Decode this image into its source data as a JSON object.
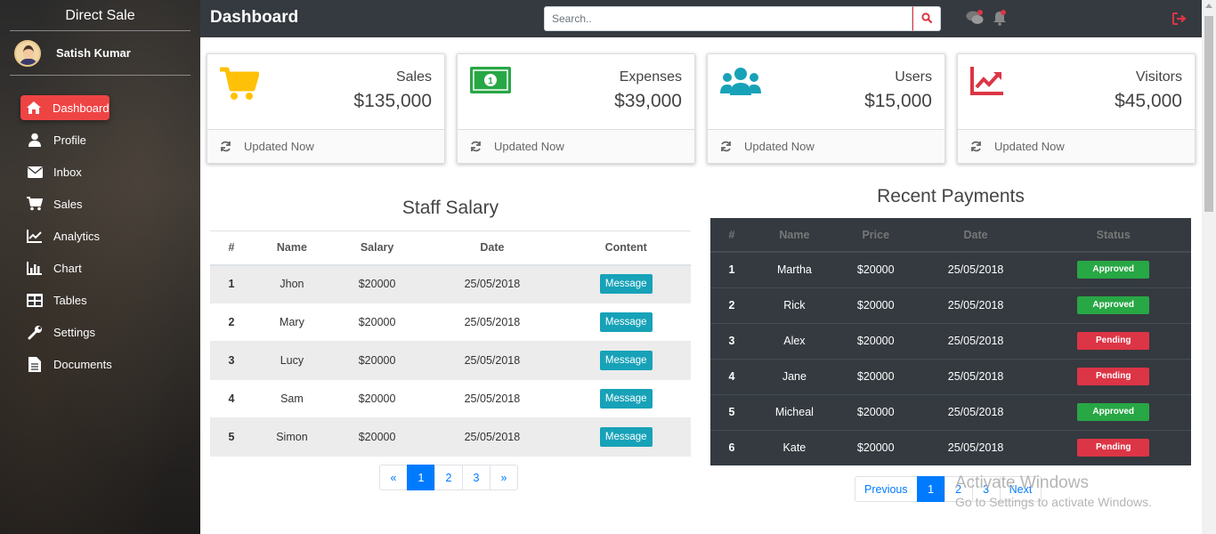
{
  "sidebar": {
    "brand": "Direct Sale",
    "user_name": "Satish Kumar",
    "items": [
      {
        "label": "Dashboard",
        "icon": "home-icon"
      },
      {
        "label": "Profile",
        "icon": "user-icon"
      },
      {
        "label": "Inbox",
        "icon": "envelope-icon"
      },
      {
        "label": "Sales",
        "icon": "cart-icon"
      },
      {
        "label": "Analytics",
        "icon": "line-chart-icon"
      },
      {
        "label": "Chart",
        "icon": "bar-chart-icon"
      },
      {
        "label": "Tables",
        "icon": "table-icon"
      },
      {
        "label": "Settings",
        "icon": "wrench-icon"
      },
      {
        "label": "Documents",
        "icon": "document-icon"
      }
    ]
  },
  "header": {
    "title": "Dashboard",
    "search_placeholder": "Search.."
  },
  "cards": [
    {
      "label": "Sales",
      "value": "$135,000",
      "footer": "Updated Now",
      "icon": "cart-icon",
      "color": "#ffc107"
    },
    {
      "label": "Expenses",
      "value": "$39,000",
      "footer": "Updated Now",
      "icon": "money-icon",
      "color": "#28a745"
    },
    {
      "label": "Users",
      "value": "$15,000",
      "footer": "Updated Now",
      "icon": "users-icon",
      "color": "#17a2b8"
    },
    {
      "label": "Visitors",
      "value": "$45,000",
      "footer": "Updated Now",
      "icon": "trend-icon",
      "color": "#dc3545"
    }
  ],
  "staff": {
    "title": "Staff Salary",
    "headers": [
      "#",
      "Name",
      "Salary",
      "Date",
      "Content"
    ],
    "rows": [
      {
        "id": "1",
        "name": "Jhon",
        "salary": "$20000",
        "date": "25/05/2018",
        "action": "Message"
      },
      {
        "id": "2",
        "name": "Mary",
        "salary": "$20000",
        "date": "25/05/2018",
        "action": "Message"
      },
      {
        "id": "3",
        "name": "Lucy",
        "salary": "$20000",
        "date": "25/05/2018",
        "action": "Message"
      },
      {
        "id": "4",
        "name": "Sam",
        "salary": "$20000",
        "date": "25/05/2018",
        "action": "Message"
      },
      {
        "id": "5",
        "name": "Simon",
        "salary": "$20000",
        "date": "25/05/2018",
        "action": "Message"
      }
    ],
    "pagination": [
      "«",
      "1",
      "2",
      "3",
      "»"
    ]
  },
  "payments": {
    "title": "Recent Payments",
    "headers": [
      "#",
      "Name",
      "Price",
      "Date",
      "Status"
    ],
    "rows": [
      {
        "id": "1",
        "name": "Martha",
        "price": "$20000",
        "date": "25/05/2018",
        "status": "Approved"
      },
      {
        "id": "2",
        "name": "Rick",
        "price": "$20000",
        "date": "25/05/2018",
        "status": "Approved"
      },
      {
        "id": "3",
        "name": "Alex",
        "price": "$20000",
        "date": "25/05/2018",
        "status": "Pending"
      },
      {
        "id": "4",
        "name": "Jane",
        "price": "$20000",
        "date": "25/05/2018",
        "status": "Pending"
      },
      {
        "id": "5",
        "name": "Micheal",
        "price": "$20000",
        "date": "25/05/2018",
        "status": "Approved"
      },
      {
        "id": "6",
        "name": "Kate",
        "price": "$20000",
        "date": "25/05/2018",
        "status": "Pending"
      }
    ],
    "pagination": [
      "Previous",
      "1",
      "2",
      "3",
      "Next"
    ]
  },
  "watermark": {
    "line1": "Activate Windows",
    "line2": "Go to Settings to activate Windows."
  },
  "colors": {
    "accent": "#ef4444",
    "header_bg": "#343a40",
    "primary": "#007bff",
    "info": "#17a2b8",
    "success": "#28a745",
    "danger": "#dc3545"
  }
}
